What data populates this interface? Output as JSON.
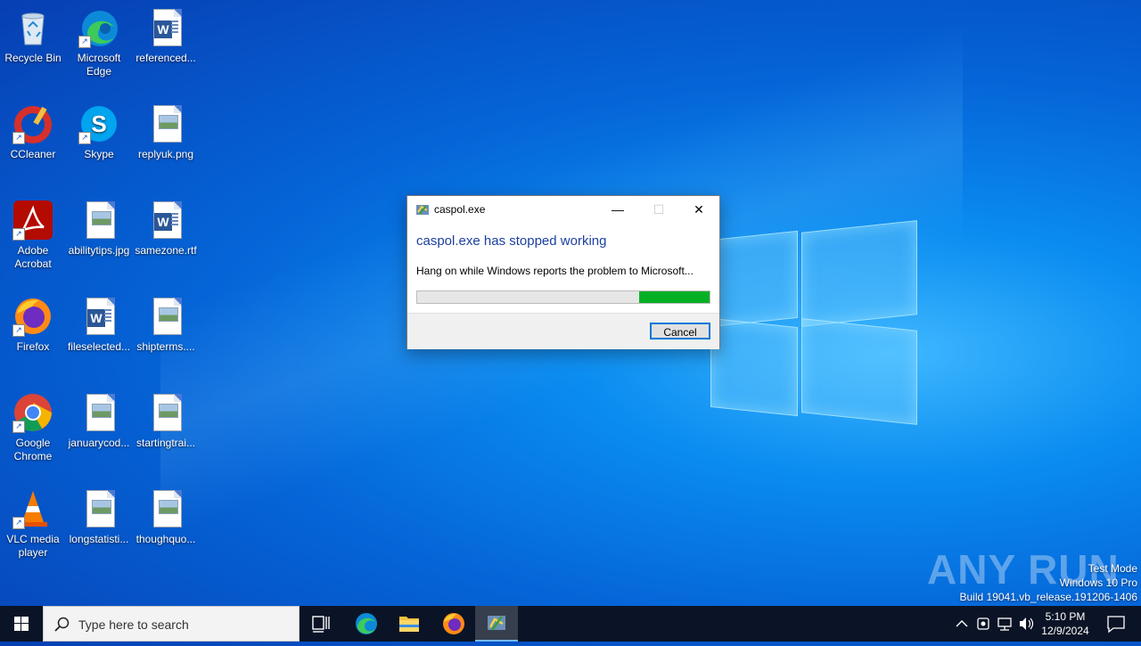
{
  "desktop": {
    "icons": [
      {
        "label": "Recycle Bin"
      },
      {
        "label": "Microsoft Edge"
      },
      {
        "label": "referenced..."
      },
      {
        "label": "CCleaner"
      },
      {
        "label": "Skype"
      },
      {
        "label": "replyuk.png"
      },
      {
        "label": "Adobe Acrobat"
      },
      {
        "label": "abilitytips.jpg"
      },
      {
        "label": "samezone.rtf"
      },
      {
        "label": "Firefox"
      },
      {
        "label": "fileselected..."
      },
      {
        "label": "shipterms...."
      },
      {
        "label": "Google Chrome"
      },
      {
        "label": "januarycod..."
      },
      {
        "label": "startingtrai..."
      },
      {
        "label": "VLC media player"
      },
      {
        "label": "longstatisti..."
      },
      {
        "label": "thoughquo..."
      }
    ]
  },
  "dialog": {
    "title": "caspol.exe",
    "heading": "caspol.exe has stopped working",
    "message": "Hang on while Windows reports the problem to Microsoft...",
    "progress_fraction": 0.24,
    "cancel_label": "Cancel",
    "minimize_glyph": "—",
    "maximize_glyph": "☐",
    "close_glyph": "✕"
  },
  "watermark": {
    "logo_text": "ANY RUN",
    "line1": "Test Mode",
    "line2": "Windows 10 Pro",
    "line3": "Build 19041.vb_release.191206-1406"
  },
  "taskbar": {
    "search_placeholder": "Type here to search",
    "time": "5:10 PM",
    "date": "12/9/2024"
  },
  "colors": {
    "accent": "#0078d7",
    "progress": "#06b025",
    "heading": "#1c3fa0"
  }
}
